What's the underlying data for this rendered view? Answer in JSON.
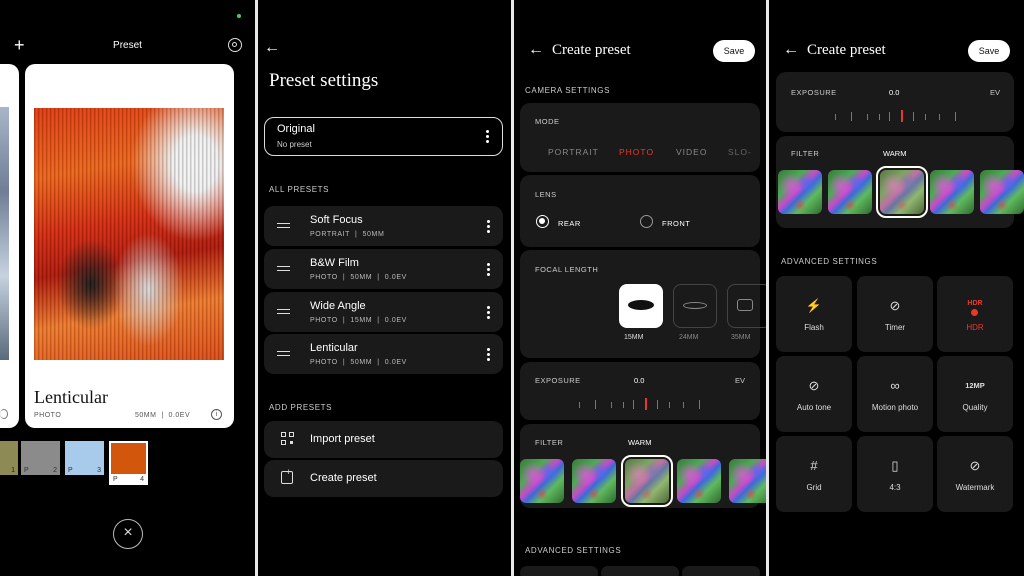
{
  "panel1": {
    "title": "Preset",
    "card_name": "Lenticular",
    "card_mode": "PHOTO",
    "card_meta": "50MM  |  0.0EV",
    "swatches": [
      {
        "label": "1",
        "color": "#8e8a56"
      },
      {
        "label": "P",
        "num": "2",
        "color": "#8b8b8b"
      },
      {
        "label": "P",
        "num": "3",
        "color": "#a8cbeb"
      },
      {
        "label": "P",
        "num": "4",
        "color": "#d3560d"
      }
    ]
  },
  "panel2": {
    "title": "Preset settings",
    "original_name": "Original",
    "original_sub": "No preset",
    "all_presets_header": "ALL PRESETS",
    "presets": [
      {
        "name": "Soft Focus",
        "meta": "PORTRAIT  |  50MM"
      },
      {
        "name": "B&W Film",
        "meta": "PHOTO  |  50MM  |  0.0EV"
      },
      {
        "name": "Wide Angle",
        "meta": "PHOTO  |  15MM  |  0.0EV"
      },
      {
        "name": "Lenticular",
        "meta": "PHOTO  |  50MM  |  0.0EV"
      }
    ],
    "add_presets_header": "ADD PRESETS",
    "import_label": "Import preset",
    "create_label": "Create preset"
  },
  "panel3": {
    "title": "Create preset",
    "save_label": "Save",
    "camera_settings_header": "CAMERA SETTINGS",
    "mode_label": "MODE",
    "modes": [
      "PORTRAIT",
      "PHOTO",
      "VIDEO",
      "SLO-"
    ],
    "selected_mode": "PHOTO",
    "lens_label": "LENS",
    "lens_rear": "REAR",
    "lens_front": "FRONT",
    "focal_label": "FOCAL LENGTH",
    "focal_options": [
      "15MM",
      "24MM",
      "35MM"
    ],
    "exposure_label": "EXPOSURE",
    "exposure_value": "0.0",
    "exposure_unit": "EV",
    "filter_label": "FILTER",
    "filter_value": "WARM",
    "advanced_header": "ADVANCED SETTINGS"
  },
  "panel4": {
    "title": "Create preset",
    "save_label": "Save",
    "exposure_label": "EXPOSURE",
    "exposure_value": "0.0",
    "exposure_unit": "EV",
    "filter_label": "FILTER",
    "filter_value": "WARM",
    "advanced_header": "ADVANCED SETTINGS",
    "advanced": [
      {
        "label": "Flash",
        "icon": "flash-off-icon",
        "glyph": "⚡"
      },
      {
        "label": "Timer",
        "icon": "timer-off-icon",
        "glyph": "⊘"
      },
      {
        "label": "HDR",
        "icon": "hdr-icon",
        "glyph": "HDR",
        "accent": true
      },
      {
        "label": "Auto tone",
        "icon": "auto-tone-icon",
        "glyph": "⊘"
      },
      {
        "label": "Motion photo",
        "icon": "motion-photo-icon",
        "glyph": "∞"
      },
      {
        "label": "Quality",
        "icon": "quality-icon",
        "glyph": "12MP"
      },
      {
        "label": "Grid",
        "icon": "grid-off-icon",
        "glyph": "#"
      },
      {
        "label": "4:3",
        "icon": "aspect-ratio-icon",
        "glyph": "▯"
      },
      {
        "label": "Watermark",
        "icon": "watermark-off-icon",
        "glyph": "⊘"
      }
    ]
  },
  "colors": {
    "accent_red": "#e8382e",
    "card_bg": "#1a1a1a"
  }
}
